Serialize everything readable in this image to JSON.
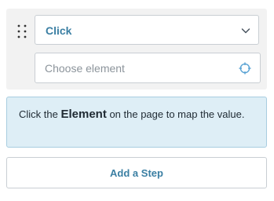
{
  "step": {
    "drag_handle_icon": "drag-dots-icon",
    "action_select": {
      "value": "Click",
      "icon": "chevron-down-icon"
    },
    "element_field": {
      "placeholder": "Choose element",
      "value": "",
      "picker_icon": "crosshair-target-icon"
    }
  },
  "info": {
    "text_before": "Click the ",
    "text_bold": "Element",
    "text_after": " on the page to map the value."
  },
  "actions": {
    "add_step_label": "Add a Step"
  },
  "colors": {
    "accent": "#3b7fa3",
    "info_background": "#deeef6",
    "info_border": "#a8cde0",
    "card_background": "#f2f2f2",
    "field_border": "#c9ced3",
    "picker_icon": "#5aa3d4"
  }
}
